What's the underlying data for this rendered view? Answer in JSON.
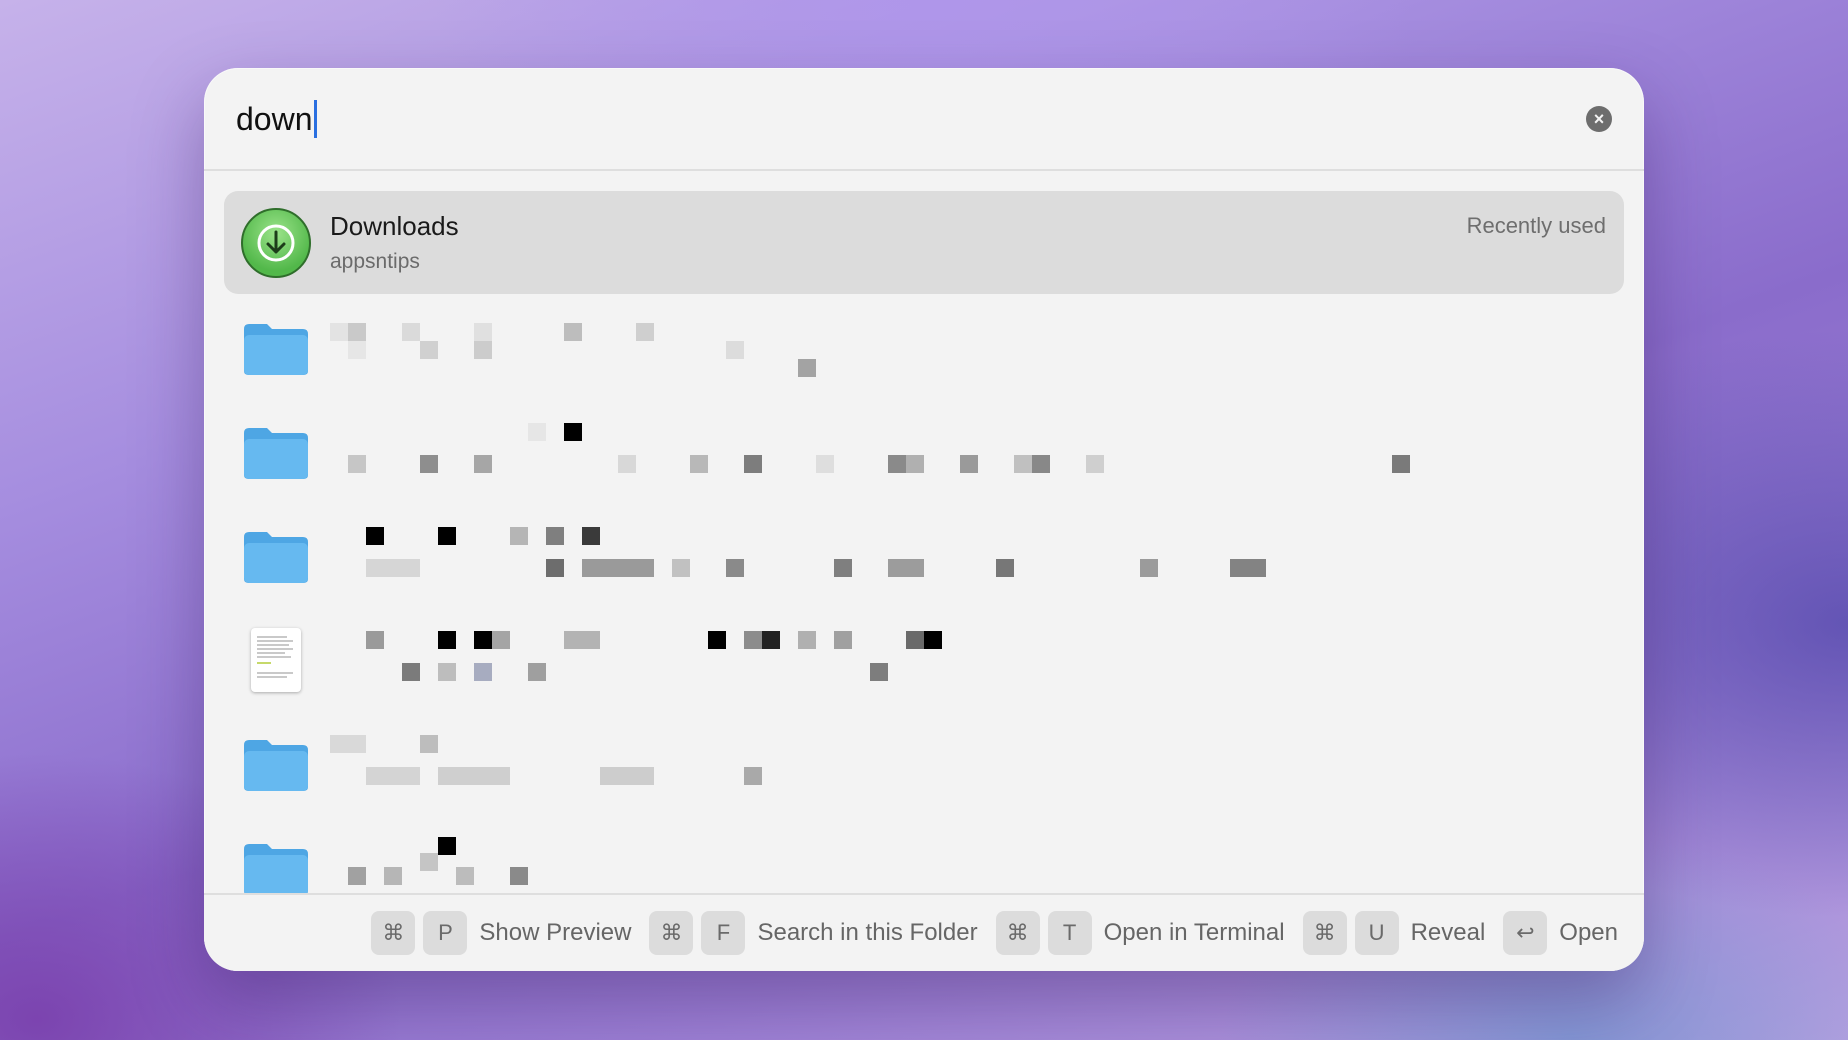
{
  "search": {
    "query": "down",
    "clear_icon": "xmark-circle-icon"
  },
  "results": [
    {
      "title": "Downloads",
      "subtitle": "appsntips",
      "accessory": "Recently used",
      "icon": "downloads-folder-icon",
      "selected": true
    },
    {
      "icon": "folder-icon",
      "redacted": true
    },
    {
      "icon": "folder-icon",
      "redacted": true
    },
    {
      "icon": "folder-icon",
      "redacted": true
    },
    {
      "icon": "document-icon",
      "redacted": true
    },
    {
      "icon": "folder-icon",
      "redacted": true
    },
    {
      "icon": "folder-icon",
      "redacted": true
    }
  ],
  "footer": {
    "show_preview": {
      "keys": [
        "⌘",
        "P"
      ],
      "label": "Show Preview"
    },
    "search_folder": {
      "keys": [
        "⌘",
        "F"
      ],
      "label": "Search in this Folder"
    },
    "open_terminal": {
      "keys": [
        "⌘",
        "T"
      ],
      "label": "Open in Terminal"
    },
    "reveal": {
      "keys": [
        "⌘",
        "U"
      ],
      "label": "Reveal"
    },
    "open": {
      "keys": [
        "↩"
      ],
      "label": "Open"
    }
  },
  "colors": {
    "accent_caret": "#2a6fe0",
    "folder_blue": "#5fb3ec",
    "selected_row": "#dcdcdc"
  }
}
